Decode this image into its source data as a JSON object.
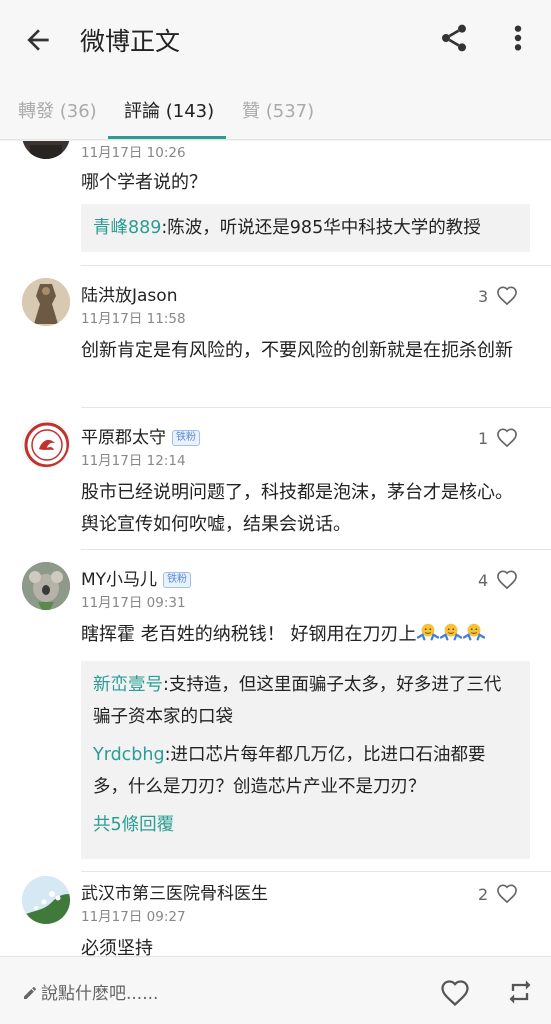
{
  "appbar": {
    "title": "微博正文",
    "back_icon": "arrow-left-icon",
    "share_icon": "share-icon",
    "more_icon": "more-vertical-icon"
  },
  "tabs": [
    {
      "label": "轉發 (36)",
      "active": false
    },
    {
      "label": "評論 (143)",
      "active": true
    },
    {
      "label": "贊 (537)",
      "active": false
    }
  ],
  "accent_color": "#2a9d94",
  "comments": [
    {
      "time": "11月17日 10:26",
      "text": "哪个学者说的？",
      "replies": [
        {
          "user": "青峰889",
          "text": ":陈波，听说还是985华中科技大学的教授"
        }
      ]
    },
    {
      "name": "陆洪放Jason",
      "time": "11月17日 11:58",
      "likes": "3",
      "text": "创新肯定是有风险的，不要风险的创新就是在扼杀创新"
    },
    {
      "name": "平原郡太守",
      "badge": "铁粉",
      "time": "11月17日 12:14",
      "likes": "1",
      "text": "股市已经说明问题了，科技都是泡沫，茅台才是核心。舆论宣传如何吹嘘，结果会说话。"
    },
    {
      "name": "MY小马儿",
      "badge": "铁粉",
      "time": "11月17日 09:31",
      "likes": "4",
      "text": "瞎挥霍 老百姓的纳税钱！ 好钢用在刀刃上",
      "emoji_icon": "shrug-emoji-icon",
      "replies": [
        {
          "user": "新峦壹号",
          "text": ":支持造，但这里面骗子太多，好多进了三代骗子资本家的口袋"
        },
        {
          "user": "Yrdcbhg",
          "text": ":进口芯片每年都几万亿，比进口石油都要多，什么是刀刃？创造芯片产业不是刀刃？"
        }
      ],
      "more_replies": "共5條回覆"
    },
    {
      "name": "武汉市第三医院骨科医生",
      "time": "11月17日 09:27",
      "likes": "2",
      "text": "必须坚持"
    }
  ],
  "bottombar": {
    "placeholder": "說點什麽吧......",
    "like_icon": "heart-outline-icon",
    "repost_icon": "repost-icon"
  }
}
